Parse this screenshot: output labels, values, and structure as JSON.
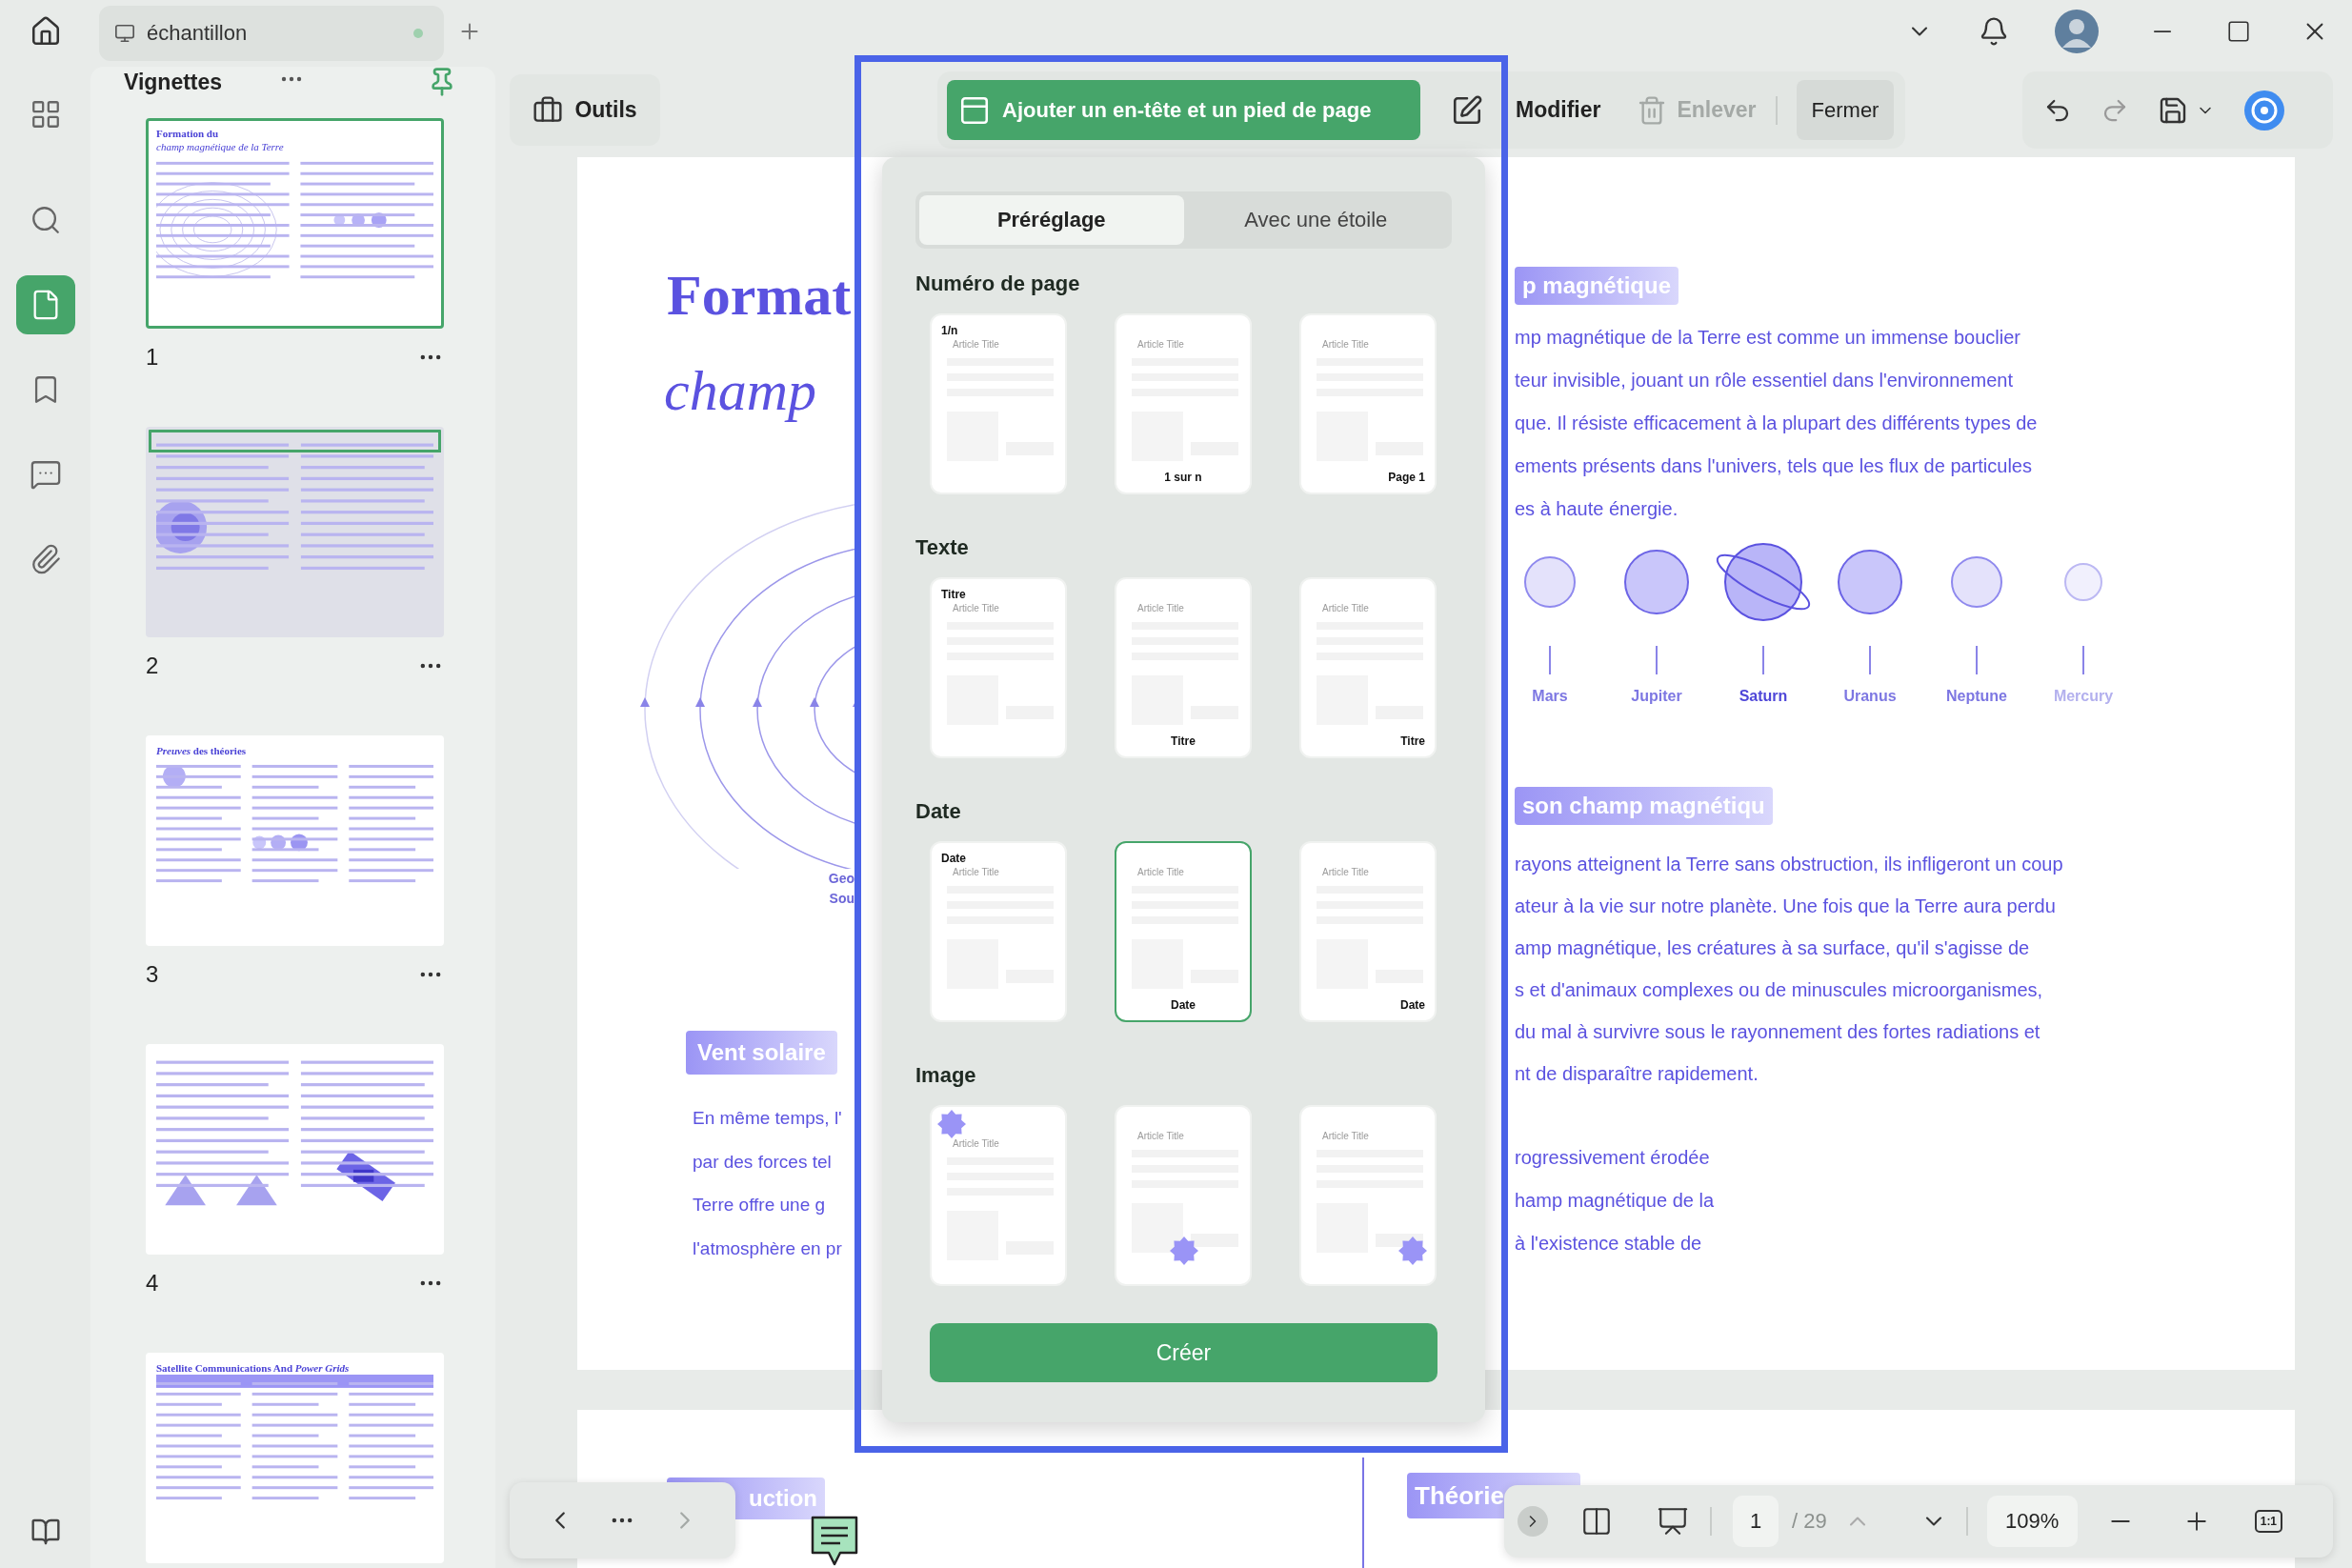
{
  "title_bar": {
    "tab_title": "échantillon"
  },
  "rail": [
    {
      "kind": "grid",
      "selected": false
    },
    {
      "kind": "search",
      "selected": false
    },
    {
      "kind": "pages",
      "selected": true
    },
    {
      "kind": "bookmark",
      "selected": false
    },
    {
      "kind": "comment",
      "selected": false
    },
    {
      "kind": "attachment",
      "selected": false
    }
  ],
  "sidebar": {
    "title": "Vignettes",
    "pinned": true
  },
  "thumbnails": [
    {
      "number": "1",
      "kind": "cover",
      "selected": true,
      "dimmed": false,
      "marked": false,
      "title": "Formation du",
      "subtitle": "champ magnétique de la Terre"
    },
    {
      "number": "2",
      "kind": "sections",
      "selected": false,
      "dimmed": true,
      "marked": true
    },
    {
      "number": "3",
      "kind": "three-column",
      "selected": false,
      "dimmed": false,
      "marked": false,
      "title": "*Preuves* des théories"
    },
    {
      "number": "4",
      "kind": "satellite",
      "selected": false,
      "dimmed": false,
      "marked": false
    },
    {
      "kind": "table",
      "selected": false,
      "dimmed": false,
      "marked": false,
      "title": "Satellite Communications And *Power Grids*"
    }
  ],
  "toolbar": {
    "tools": "Outils",
    "add_header_footer": "Ajouter un en-tête et un pied de page",
    "modify": "Modifier",
    "remove": {
      "label": "Enlever",
      "disabled": true
    },
    "close": "Fermer"
  },
  "popup": {
    "tabs": [
      {
        "label": "Préréglage",
        "selected": true
      },
      {
        "label": "Avec une étoile",
        "selected": false
      }
    ],
    "sections": [
      {
        "title": "Numéro de page",
        "cards": [
          {
            "kind": "top-label",
            "label": "1/n",
            "sample": "Article Title",
            "selected": false
          },
          {
            "kind": "center-label",
            "label": "1 sur n",
            "sample": "Article Title",
            "selected": false
          },
          {
            "kind": "right-label",
            "label": "Page 1",
            "sample": "Article Title",
            "selected": false
          }
        ]
      },
      {
        "title": "Texte",
        "cards": [
          {
            "kind": "top-label",
            "label": "Titre",
            "sample": "Article Title",
            "selected": false
          },
          {
            "kind": "center-label",
            "label": "Titre",
            "sample": "Article Title",
            "selected": false
          },
          {
            "kind": "right-label",
            "label": "Titre",
            "sample": "Article Title",
            "selected": false
          }
        ]
      },
      {
        "title": "Date",
        "cards": [
          {
            "kind": "top-label",
            "label": "Date",
            "sample": "Article Title",
            "selected": false
          },
          {
            "kind": "center-label",
            "label": "Date",
            "sample": "Article Title",
            "selected": true
          },
          {
            "kind": "right-label",
            "label": "Date",
            "sample": "Article Title",
            "selected": false
          }
        ]
      },
      {
        "title": "Image",
        "cards": [
          {
            "kind": "top-star",
            "sample": "Article Title",
            "selected": false
          },
          {
            "kind": "center-star",
            "sample": "Article Title",
            "selected": false
          },
          {
            "kind": "right-star",
            "sample": "Article Title",
            "selected": false
          }
        ]
      }
    ],
    "create_button": "Créer"
  },
  "document": {
    "title": "Format",
    "subtitle": "champ",
    "diagram_labels": [
      "Geo",
      "Sou"
    ],
    "left_heading": "Vent solaire",
    "left_lines": [
      "En même temps, l'",
      "par des forces tel",
      "Terre offre une g",
      "l'atmosphère en pr"
    ],
    "right_sections": [
      {
        "heading": "p magnétique",
        "lines": [
          "mp magnétique de la Terre est comme un immense bouclier",
          "teur invisible, jouant un rôle essentiel dans l'environnement",
          "que. Il résiste efficacement à la plupart des différents types de",
          "ements présents dans l'univers, tels que les flux de particules",
          "es à haute énergie."
        ]
      },
      {
        "heading": "son champ magnétiqu",
        "lines": [
          "rayons atteignent la Terre sans obstruction, ils infligeront un coup",
          "ateur à la vie sur notre planète. Une fois que la Terre aura perdu",
          "amp magnétique, les créatures à sa surface, qu'il s'agisse de",
          "s et d'animaux complexes ou de minuscules microorganismes,",
          "du mal à survivre sous le rayonnement des fortes radiations et",
          "nt de disparaître rapidement."
        ]
      }
    ],
    "planets": [
      {
        "name": "Mars",
        "kind": "medium"
      },
      {
        "name": "Jupiter",
        "kind": "large"
      },
      {
        "name": "Saturn",
        "kind": "ringed"
      },
      {
        "name": "Uranus",
        "kind": "large"
      },
      {
        "name": "Neptune",
        "kind": "medium"
      },
      {
        "name": "Mercury",
        "kind": "small"
      }
    ],
    "closing_lines": [
      "rogressivement érodée",
      "hamp magnétique de la",
      "à l'existence stable de"
    ],
    "page2_headings": [
      "uction",
      "Théorie"
    ]
  },
  "page_nav": {
    "next_disabled": true
  },
  "viewer_bar": {
    "page": "1",
    "total": "/ 29",
    "zoom": "109%",
    "actual_size": "1:1"
  }
}
